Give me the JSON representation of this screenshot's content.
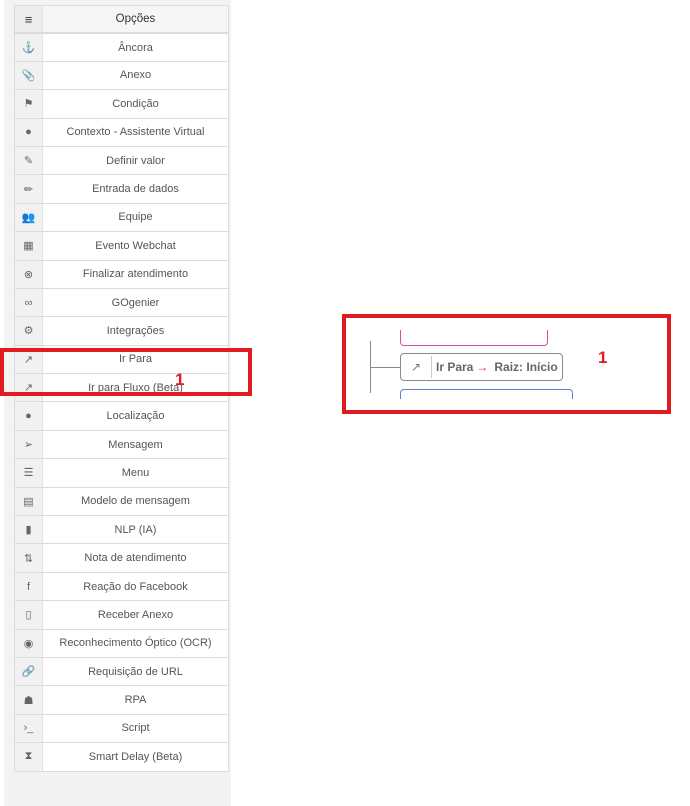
{
  "menu": {
    "header": {
      "icon": "hamburger-icon",
      "glyph": "≡",
      "label": "Opções"
    },
    "items": [
      {
        "label": "Âncora",
        "icon": "anchor-icon",
        "glyph": "⚓"
      },
      {
        "label": "Anexo",
        "icon": "paperclip-icon",
        "glyph": "📎"
      },
      {
        "label": "Condição",
        "icon": "signpost-icon",
        "glyph": "⚑"
      },
      {
        "label": "Contexto - Assistente Virtual",
        "icon": "brain-icon",
        "glyph": "●"
      },
      {
        "label": "Definir valor",
        "icon": "edit-icon",
        "glyph": "✎"
      },
      {
        "label": "Entrada de dados",
        "icon": "pencil-icon",
        "glyph": "✏"
      },
      {
        "label": "Equipe",
        "icon": "users-icon",
        "glyph": "👥"
      },
      {
        "label": "Evento Webchat",
        "icon": "calendar-icon",
        "glyph": "▦"
      },
      {
        "label": "Finalizar atendimento",
        "icon": "close-circle-icon",
        "glyph": "⊗"
      },
      {
        "label": "GOgenier",
        "icon": "infinity-icon",
        "glyph": "∞"
      },
      {
        "label": "Integrações",
        "icon": "cogs-icon",
        "glyph": "⚙"
      },
      {
        "label": "Ir Para",
        "icon": "external-link-icon",
        "glyph": "↗"
      },
      {
        "label": "Ir para Fluxo (Beta)",
        "icon": "external-link-icon",
        "glyph": "↗"
      },
      {
        "label": "Localização",
        "icon": "map-marker-icon",
        "glyph": "●"
      },
      {
        "label": "Mensagem",
        "icon": "paper-plane-icon",
        "glyph": "➢"
      },
      {
        "label": "Menu",
        "icon": "list-icon",
        "glyph": "☰"
      },
      {
        "label": "Modelo de mensagem",
        "icon": "template-icon",
        "glyph": "▤"
      },
      {
        "label": "NLP (IA)",
        "icon": "chip-icon",
        "glyph": "▮"
      },
      {
        "label": "Nota de atendimento",
        "icon": "sort-icon",
        "glyph": "⇅"
      },
      {
        "label": "Reação do Facebook",
        "icon": "facebook-icon",
        "glyph": "f"
      },
      {
        "label": "Receber Anexo",
        "icon": "file-icon",
        "glyph": "▯"
      },
      {
        "label": "Reconhecimento Óptico (OCR)",
        "icon": "eye-icon",
        "glyph": "◉"
      },
      {
        "label": "Requisição de URL",
        "icon": "link-icon",
        "glyph": "🔗"
      },
      {
        "label": "RPA",
        "icon": "robot-icon",
        "glyph": "☗"
      },
      {
        "label": "Script",
        "icon": "terminal-icon",
        "glyph": "›_"
      },
      {
        "label": "Smart Delay (Beta)",
        "icon": "hourglass-icon",
        "glyph": "⧗"
      }
    ]
  },
  "annotations": {
    "left_number": "1",
    "right_number": "1"
  },
  "diagram": {
    "node": {
      "icon": "external-link-icon",
      "glyph": "↗",
      "action": "Ir Para",
      "arrow": "→",
      "target": "Raiz: Início"
    }
  },
  "colors": {
    "highlight": "#e21b22",
    "pink_branch": "#d54fa0",
    "blue_branch": "#5a86c6"
  }
}
